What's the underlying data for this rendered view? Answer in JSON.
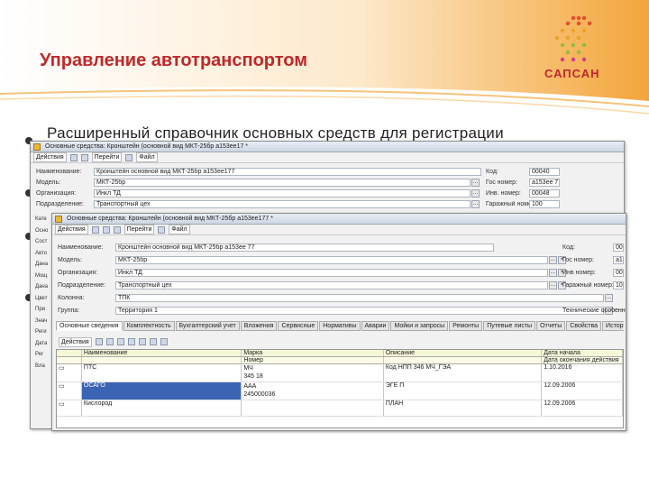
{
  "slide": {
    "title": "Управление автотранспортом",
    "logo_text": "САПСАН",
    "bullet_text": "Расширенный справочник основных средств для регистрации"
  },
  "back_window": {
    "title": "Основные средства: Кронштейн (основной вид МКТ-25бр а153ее17 *",
    "toolbar": [
      "Действия",
      "Перейти",
      "Файл"
    ],
    "fields": [
      {
        "label": "Наименование:",
        "value": "Кронштейн основной вид МКТ-25бр а153ее177"
      },
      {
        "label": "Модель:",
        "value": "МКТ-25бр"
      },
      {
        "label": "Организация:",
        "value": "Инкл ТД"
      },
      {
        "label": "Подразделение:",
        "value": "Транспортный цех"
      }
    ],
    "right_fields": [
      {
        "label": "Код:",
        "value": "00040"
      },
      {
        "label": "Гос номер:",
        "value": "а153ее 77"
      },
      {
        "label": "Инв. номер:",
        "value": "00048"
      },
      {
        "label": "Гаражный номер:",
        "value": "100"
      }
    ],
    "left_labels": [
      "Кате",
      "Осно",
      "Сост",
      "Авто",
      "Дана",
      "Мощ",
      "Дана",
      "Цвет",
      "При",
      "Знач",
      "Реги",
      "Дата",
      "Рег",
      "Вла"
    ]
  },
  "front_window": {
    "title": "Основные средства: Кронштейн (основной вид МКТ-25бр а153ее177 *",
    "toolbar": [
      "Действия",
      "Перейти",
      "Файл"
    ],
    "fields": [
      {
        "label": "Наименование:",
        "value": "Кронштейн основной вид МКТ-25бр а153ее 77"
      },
      {
        "label": "Модель:",
        "value": "МКТ-25бр"
      },
      {
        "label": "Организация:",
        "value": "Инкл ТД"
      },
      {
        "label": "Подразделение:",
        "value": "Транспортный цех"
      },
      {
        "label": "Колонна:",
        "value": "ТПК"
      },
      {
        "label": "Группа:",
        "value": "Территория 1"
      }
    ],
    "right_fields": [
      {
        "label": "Код:",
        "value": "00"
      },
      {
        "label": "Гос номер:",
        "value": "а1"
      },
      {
        "label": "Инв номер:",
        "value": "00"
      },
      {
        "label": "Гаражный номер:",
        "value": "10"
      }
    ],
    "side_note": "Технические особенности",
    "tabs": [
      "Основные сведения",
      "Комплектность",
      "Бухгалтерский учет",
      "Вложения",
      "Сервисные",
      "Нормативы",
      "Аварии",
      "Мойки и запросы",
      "Ремонты",
      "Путевые листы",
      "Отчеты",
      "Свойства",
      "История"
    ],
    "grid_headers": [
      "Наименование",
      "Марка",
      "Описание",
      "Дата начала"
    ],
    "grid_subheaders": [
      "",
      "",
      "Номер",
      "",
      "Дата окончания действия"
    ],
    "grid_rows": [
      {
        "marker": "▭",
        "name": "ПТС",
        "mark": "МЧ",
        "sub": "345 18",
        "desc": "Код НПП 346 МЧ_ГЭА",
        "date": "1.10.2016"
      },
      {
        "marker": "▭",
        "name": "ОСАГО",
        "mark": "ААА",
        "sub": "245000036",
        "desc": "ЭГЕ П",
        "date": "12.09.2006"
      },
      {
        "marker": "▭",
        "name": "Кислород",
        "mark": "",
        "sub": "",
        "desc": "ПЛАН",
        "date": "12.09.2006"
      }
    ]
  },
  "colors": {
    "title": "#c0282a",
    "accent": "#f3a53a",
    "selection": "#3c64b4"
  }
}
